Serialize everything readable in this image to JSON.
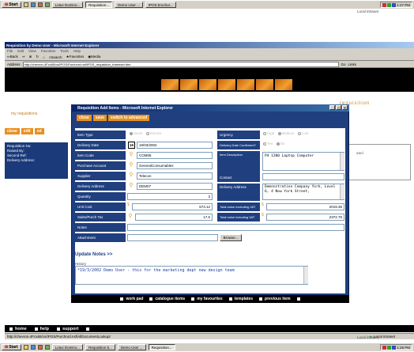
{
  "taskbar_top": {
    "start": "Start",
    "buttons": [
      "Lotus Domino...",
      "Requisition...",
      "Demo User ...",
      "IPOS brochur..."
    ],
    "tray_text": "Local intranet",
    "clock": "1:27 PM"
  },
  "taskbar_bottom": {
    "start": "Start",
    "buttons": [
      "Lotus Domino...",
      "Requisition b...",
      "Demo User ...",
      "Requisition..."
    ],
    "tray_text": "Local intranet",
    "clock": "1:28 PM"
  },
  "ie": {
    "title": "Requisition by Demo User - Microsoft Internet Explorer",
    "menu": [
      "File",
      "Edit",
      "View",
      "Favorites",
      "Tools",
      "Help"
    ],
    "toolbar": [
      "Back",
      "Search",
      "Favorites",
      "Media"
    ],
    "address_label": "Address",
    "address": "http://chevron-4Fcx65/cs/IPOS/Purchord.nsf/IPOS_requisition_frameset.htm",
    "go": "Go",
    "links": "Links",
    "logo": "iPOS.",
    "my_requisitions": "my requisitions",
    "tagline": "requisition",
    "left_buttons": [
      "close",
      "edit",
      "ed"
    ],
    "left_fields": [
      "Requisition No:",
      "Raised By:",
      "Second Ref:",
      "Delivery Address:"
    ],
    "right_label": "ated",
    "bottom_nav": [
      "home",
      "help",
      "support"
    ],
    "status_url": "http://chevron-4Fcx65/cs/IPOS/Purchord.nsf/AllDocumentLookup/",
    "status_zone": "Local intranet"
  },
  "dialog": {
    "title": "Requisition Add Items - Microsoft Internet Explorer",
    "buttons": [
      "close",
      "save",
      "switch to advanced"
    ],
    "labels": {
      "item_type": "Item Type",
      "delivery_date": "Delivery Date",
      "item_code": "Item Code",
      "purchase_account": "Purchase Account",
      "supplier": "Supplier",
      "delivery_address": "Delivery Address",
      "quantity": "Quantity",
      "unit_cost": "Unit Cost",
      "sales_tax": "Sales/Purch Tax",
      "notes": "Notes",
      "attachment": "Attachment",
      "urgency": "Urgency",
      "delivery_confirmed": "Delivery Date Confirmed?",
      "item_description": "Item Description",
      "contact": "Contact",
      "delivery_address_full": "Delivery Address",
      "total_ex": "Total value excluding VAT",
      "total_inc": "Total value including VAT"
    },
    "item_type_options": [
      "Stock",
      "Service"
    ],
    "urgency_options": [
      "High",
      "Medium",
      "Low"
    ],
    "confirmed_options": [
      "Yes",
      "No"
    ],
    "values": {
      "delivery_date": "19/03/2002",
      "item_code": "COM05",
      "purchase_account": "GeneralConsumables",
      "supplier": "Telecon",
      "delivery_address": "DEM07",
      "quantity": "3",
      "unit_cost": "673.12",
      "sales_tax": "17.5",
      "item_description": "P4 1200 Laptop Computer",
      "delivery_address_full": "Demonstration Company York, Level 6, 4 New York Street,",
      "total_ex": "2019.36",
      "total_inc": "2372.75"
    },
    "calendar_icon": "16",
    "browse": "Browse...",
    "update_notes": "Update Notes >>",
    "history_label": "History",
    "history_text": "*19/3/2002 Demo User - this for the marketing dept new design team",
    "nav": [
      "work pad",
      "catalogue items",
      "my favourites",
      "templates",
      "previous item"
    ]
  }
}
